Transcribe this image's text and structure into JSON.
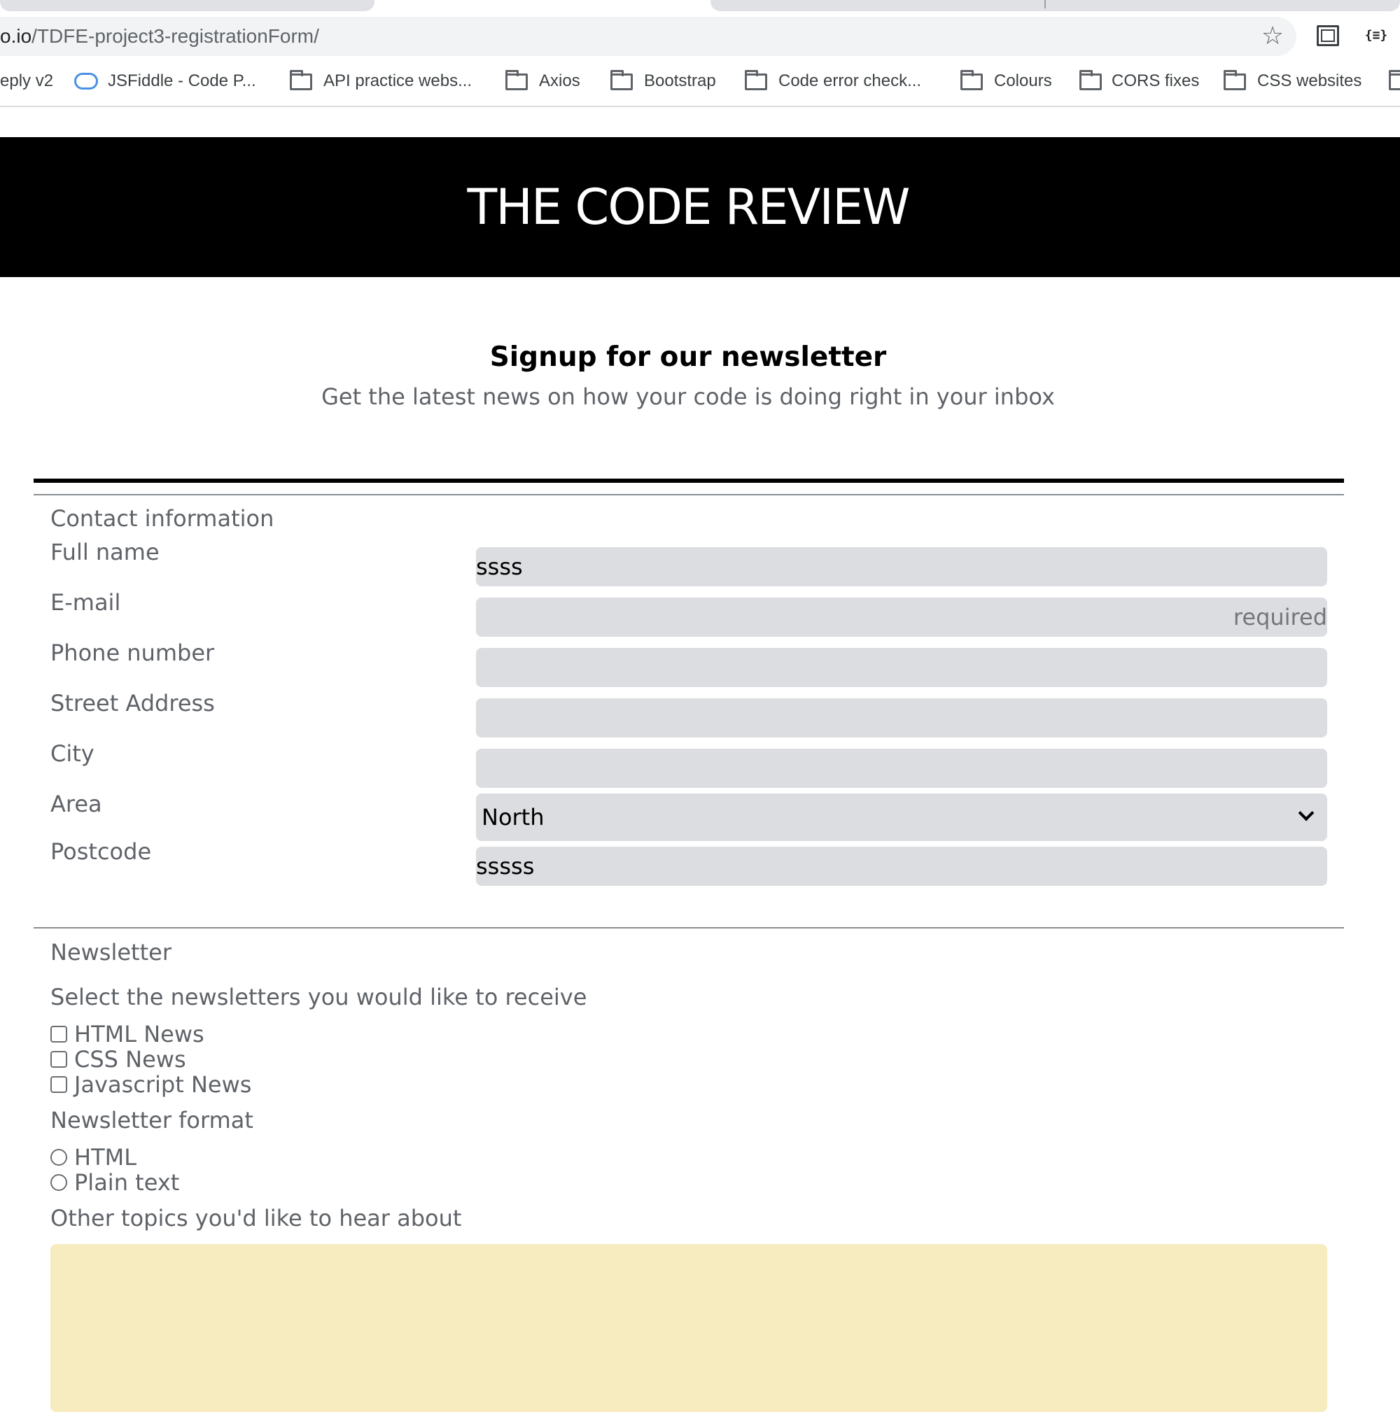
{
  "browser": {
    "url_host": "o.io",
    "url_path": "/TDFE-project3-registrationForm/",
    "bookmarks": [
      {
        "label": "eply v2",
        "icon": "none"
      },
      {
        "label": "JSFiddle - Code P...",
        "icon": "cloud-icon"
      },
      {
        "label": "API practice webs...",
        "icon": "folder-icon"
      },
      {
        "label": "Axios",
        "icon": "folder-icon"
      },
      {
        "label": "Bootstrap",
        "icon": "folder-icon"
      },
      {
        "label": "Code error check...",
        "icon": "folder-icon"
      },
      {
        "label": "Colours",
        "icon": "folder-icon"
      },
      {
        "label": "CORS fixes",
        "icon": "folder-icon"
      },
      {
        "label": "CSS websites",
        "icon": "folder-icon"
      }
    ],
    "ext_label": "{≡}"
  },
  "header": {
    "title": "THE CODE REVIEW"
  },
  "intro": {
    "title": "Signup for our newsletter",
    "subtitle": "Get the latest news on how your code is doing right in your inbox"
  },
  "contact": {
    "legend": "Contact information",
    "full_name": {
      "label": "Full name",
      "value": "ssss",
      "placeholder": ""
    },
    "email": {
      "label": "E-mail",
      "value": "",
      "placeholder": "required"
    },
    "phone": {
      "label": "Phone number",
      "value": "",
      "placeholder": ""
    },
    "street": {
      "label": "Street Address",
      "value": "",
      "placeholder": ""
    },
    "city": {
      "label": "City",
      "value": "",
      "placeholder": ""
    },
    "area": {
      "label": "Area",
      "selected": "North"
    },
    "postcode": {
      "label": "Postcode",
      "value": "sssss",
      "placeholder": ""
    }
  },
  "newsletter": {
    "legend": "Newsletter",
    "select_prompt": "Select the newsletters you would like to receive",
    "options": [
      {
        "label": "HTML News",
        "checked": false
      },
      {
        "label": "CSS News",
        "checked": false
      },
      {
        "label": "Javascript News",
        "checked": false
      }
    ],
    "format_prompt": "Newsletter format",
    "formats": [
      {
        "label": "HTML",
        "selected": false
      },
      {
        "label": "Plain text",
        "selected": false
      }
    ],
    "topics_prompt": "Other topics you'd like to hear about",
    "topics_value": ""
  },
  "colors": {
    "banner_bg": "#000000",
    "input_bg": "#dcdde0",
    "textarea_bg": "#f6ecc0"
  }
}
